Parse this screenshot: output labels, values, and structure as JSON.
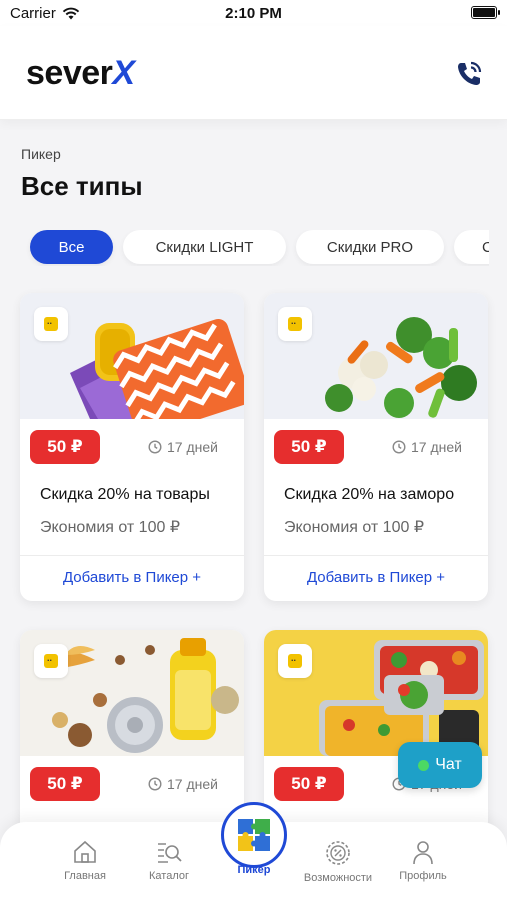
{
  "status_bar": {
    "carrier": "Carrier",
    "time": "2:10 PM"
  },
  "header": {
    "logo_main": "sever",
    "logo_accent": "X"
  },
  "breadcrumb": "Пикер",
  "page_title": "Все типы",
  "filters": [
    {
      "label": "Все",
      "active": true
    },
    {
      "label": "Скидки LIGHT",
      "active": false
    },
    {
      "label": "Скидки PRO",
      "active": false
    },
    {
      "label": "С",
      "active": false
    }
  ],
  "cards": [
    {
      "price": "50 ₽",
      "days": "17 дней",
      "title": "Скидка 20% на товары",
      "subtitle": "Экономия от 100 ₽",
      "action": "Добавить в Пикер +",
      "image": "household-goods"
    },
    {
      "price": "50 ₽",
      "days": "17 дней",
      "title": "Скидка 20% на заморо",
      "subtitle": "Экономия от 100 ₽",
      "action": "Добавить в Пикер +",
      "image": "frozen-vegetables"
    },
    {
      "price": "50 ₽",
      "days": "17 дней",
      "title": "",
      "subtitle": "",
      "action": "",
      "image": "groceries"
    },
    {
      "price": "50 ₽",
      "days": "17 дней",
      "title": "",
      "subtitle": "",
      "action": "",
      "image": "ready-meals"
    }
  ],
  "chat": {
    "label": "Чат"
  },
  "bottom_nav": [
    {
      "label": "Главная",
      "icon": "home-icon",
      "active": false
    },
    {
      "label": "Каталог",
      "icon": "catalog-search-icon",
      "active": false
    },
    {
      "label": "Пикер",
      "icon": "puzzle-icon",
      "active": true
    },
    {
      "label": "Возможности",
      "icon": "discount-gear-icon",
      "active": false
    },
    {
      "label": "Профиль",
      "icon": "profile-icon",
      "active": false
    }
  ],
  "colors": {
    "brand": "#1f49d6",
    "price_badge": "#e62e2e",
    "chat": "#1ea0c8"
  }
}
